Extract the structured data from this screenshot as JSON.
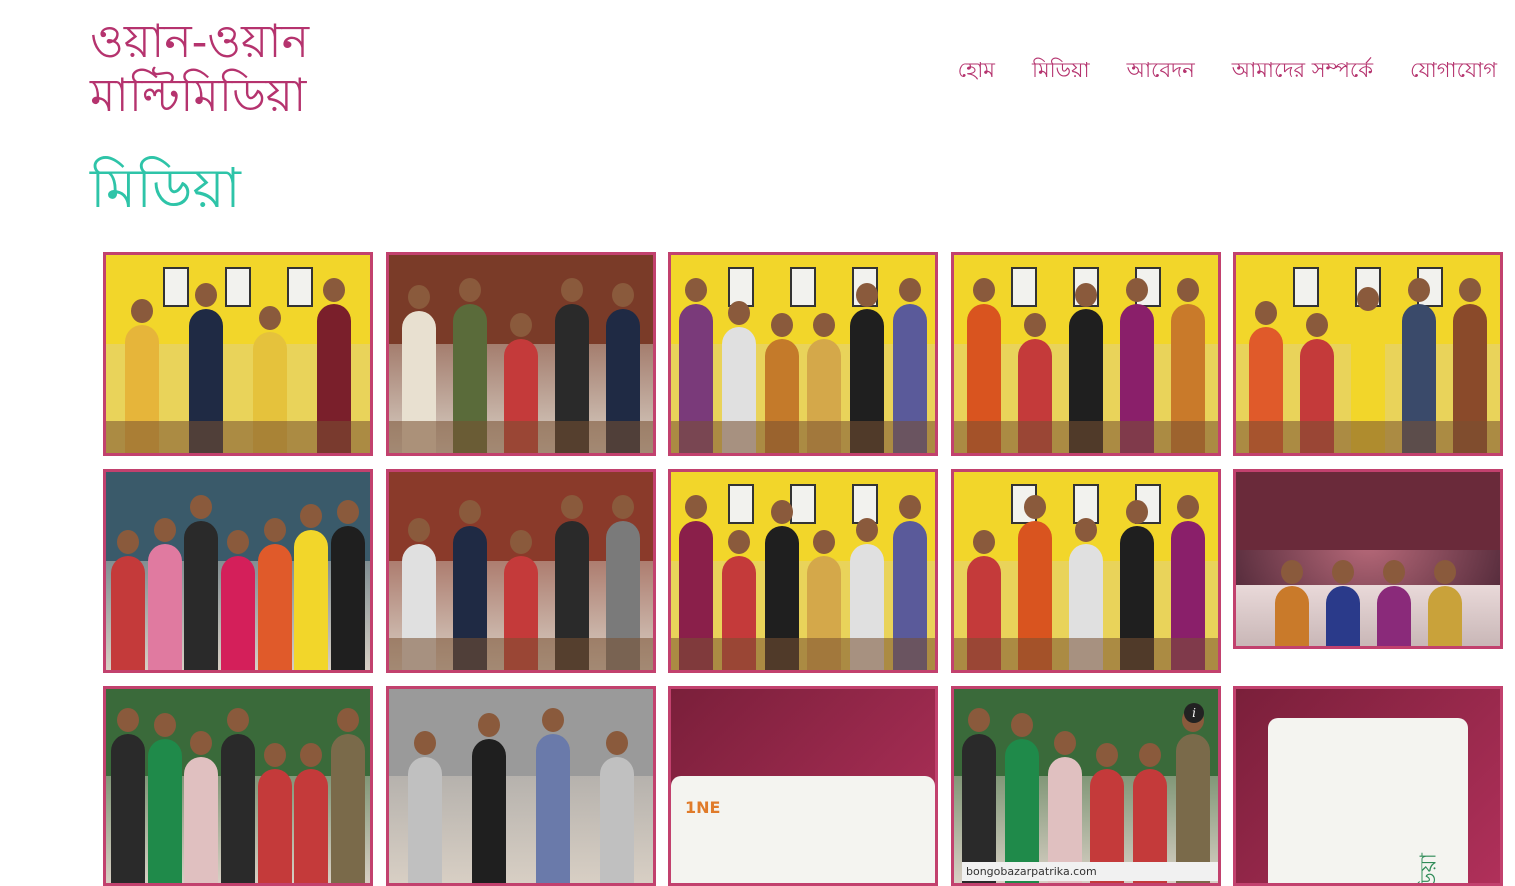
{
  "site": {
    "title_line1": "ওয়ান-ওয়ান",
    "title_line2": "মাল্টিমিডিয়া"
  },
  "nav": {
    "items": [
      {
        "label": "হোম"
      },
      {
        "label": "মিডিয়া"
      },
      {
        "label": "আবেদন"
      },
      {
        "label": "আমাদের সম্পর্কে"
      },
      {
        "label": "যোগাযোগ"
      }
    ]
  },
  "page": {
    "title": "মিডিয়া"
  },
  "colors": {
    "brand": "#b5336e",
    "page_title": "#2ec4a8",
    "tile_border": "#c2416e"
  },
  "gallery": {
    "tiles": [
      {
        "kind": "office",
        "wall": "#f2d62a",
        "crowd": [
          "#e6b53a",
          "#1f2a44",
          "#e5c23c",
          "#7a1f2b"
        ]
      },
      {
        "kind": "studio",
        "wall": "#7a3b28",
        "crowd": [
          "#e8e0d0",
          "#5a6b3a",
          "#c43a3a",
          "#2a2a2a",
          "#1f2a44"
        ]
      },
      {
        "kind": "office",
        "wall": "#f2d62a",
        "crowd": [
          "#7a3a7a",
          "#e0e0e0",
          "#c47a2a",
          "#d4a84a",
          "#1f1f1f",
          "#5a5a9a"
        ]
      },
      {
        "kind": "office",
        "wall": "#f2d62a",
        "crowd": [
          "#d9541f",
          "#c43a3a",
          "#1f1f1f",
          "#8a1f6a",
          "#c97a2a"
        ]
      },
      {
        "kind": "office",
        "wall": "#f2d62a",
        "crowd": [
          "#e05a2a",
          "#c43a3a",
          "#f2d62a",
          "#3a4a6a",
          "#8a4a2a"
        ]
      },
      {
        "kind": "banner",
        "wall": "#3a5a6a",
        "crowd": [
          "#c43a3a",
          "#e07aa0",
          "#2a2a2a",
          "#d41f5a",
          "#e05a2a",
          "#f2d62a",
          "#1f1f1f"
        ]
      },
      {
        "kind": "studio",
        "wall": "#8a3a2a",
        "crowd": [
          "#e0e0e0",
          "#1f2a44",
          "#c43a3a",
          "#2a2a2a",
          "#7a7a7a"
        ]
      },
      {
        "kind": "office",
        "wall": "#f2d62a",
        "crowd": [
          "#8a1f4a",
          "#c43a3a",
          "#1f1f1f",
          "#d4a84a",
          "#e0e0e0",
          "#5a5a9a"
        ]
      },
      {
        "kind": "office",
        "wall": "#f2d62a",
        "crowd": [
          "#c43a3a",
          "#d9541f",
          "#e0e0e0",
          "#1f1f1f",
          "#8a1f6a"
        ]
      },
      {
        "kind": "stage",
        "wall": "#6a2a3a",
        "crowd": [
          "#c97a2a",
          "#2a3a8a",
          "#8a2a7a",
          "#c9a23a"
        ]
      },
      {
        "kind": "outdoor",
        "wall": "#3a6a3a",
        "crowd": [
          "#2a2a2a",
          "#1f8a4a",
          "#e0c0c0",
          "#2a2a2a",
          "#c43a3a",
          "#c43a3a",
          "#7a6a4a"
        ]
      },
      {
        "kind": "shoot",
        "wall": "#9a9a9a",
        "crowd": [
          "#c0c0c0",
          "#1f1f1f",
          "#6a7aaa",
          "#c0c0c0"
        ]
      },
      {
        "kind": "card",
        "wall": "#7a1f3a",
        "logo": "1NE"
      },
      {
        "kind": "news",
        "wall": "#3a6a3a",
        "crowd": [
          "#2a2a2a",
          "#1f8a4a",
          "#e0c0c0",
          "#c43a3a",
          "#c43a3a",
          "#7a6a4a"
        ],
        "caption": "bongobazarpatrika.com"
      },
      {
        "kind": "card2",
        "wall": "#7a1f3a",
        "card_text": "মিডিয়া"
      }
    ]
  }
}
